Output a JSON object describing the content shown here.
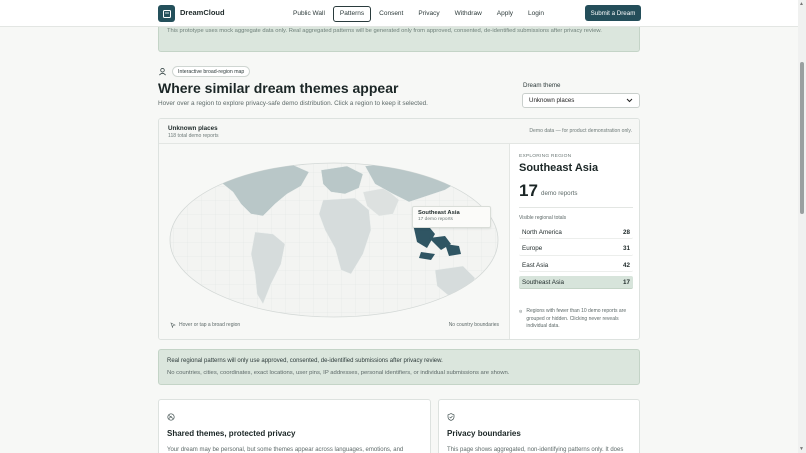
{
  "header": {
    "brand": "DreamCloud",
    "nav": [
      "Public Wall",
      "Patterns",
      "Consent",
      "Privacy",
      "Withdraw",
      "Apply",
      "Login"
    ],
    "active_nav": "Patterns",
    "submit_label": "Submit a Dream"
  },
  "top_notice": {
    "text": "This prototype uses mock aggregate data only. Real aggregated patterns will be generated only from approved, consented, de-identified submissions after privacy review."
  },
  "intro": {
    "badge": "Interactive broad-region map",
    "title": "Where similar dream themes appear",
    "subtitle": "Hover over a region to explore privacy-safe demo distribution. Click a region to keep it selected.",
    "theme_label": "Dream theme",
    "theme_value": "Unknown places"
  },
  "map_panel": {
    "title": "Unknown places",
    "total": "118 total demo reports",
    "note": "Demo data — for product demonstration only.",
    "tooltip_title": "Southeast Asia",
    "tooltip_sub": "17 demo reports",
    "hover_hint": "Hover or tap a broad region",
    "no_country": "No country boundaries"
  },
  "side_panel": {
    "exploring_label": "EXPLORING REGION",
    "region": "Southeast Asia",
    "count": "17",
    "count_label": "demo reports",
    "visible_label": "Visible regional totals",
    "rows": [
      {
        "name": "North America",
        "value": "28"
      },
      {
        "name": "Europe",
        "value": "31"
      },
      {
        "name": "East Asia",
        "value": "42"
      },
      {
        "name": "Southeast Asia",
        "value": "17"
      }
    ],
    "privacy_note": "Regions with fewer than 10 demo reports are grouped or hidden. Clicking never reveals individual data."
  },
  "mid_notice": {
    "line1": "Real regional patterns will only use approved, consented, de-identified submissions after privacy review.",
    "line2": "No countries, cities, coordinates, exact locations, user pins, IP addresses, personal identifiers, or individual submissions are shown."
  },
  "cards": [
    {
      "title": "Shared themes, protected privacy",
      "text": "Your dream may be personal, but some themes appear across languages, emotions, and cultures. This prototype shows how the archive can summarize patterns without exposing"
    },
    {
      "title": "Privacy boundaries",
      "text": "This page shows aggregated, non-identifying patterns only. It does not show individual submissions, exact locations, IP"
    }
  ],
  "colors": {
    "accent": "#244e5a",
    "highlight_region": "#2f5563",
    "land": "#b9c7c8",
    "land_light": "#d6dcdc",
    "notice_bg": "#dbe6dd"
  }
}
